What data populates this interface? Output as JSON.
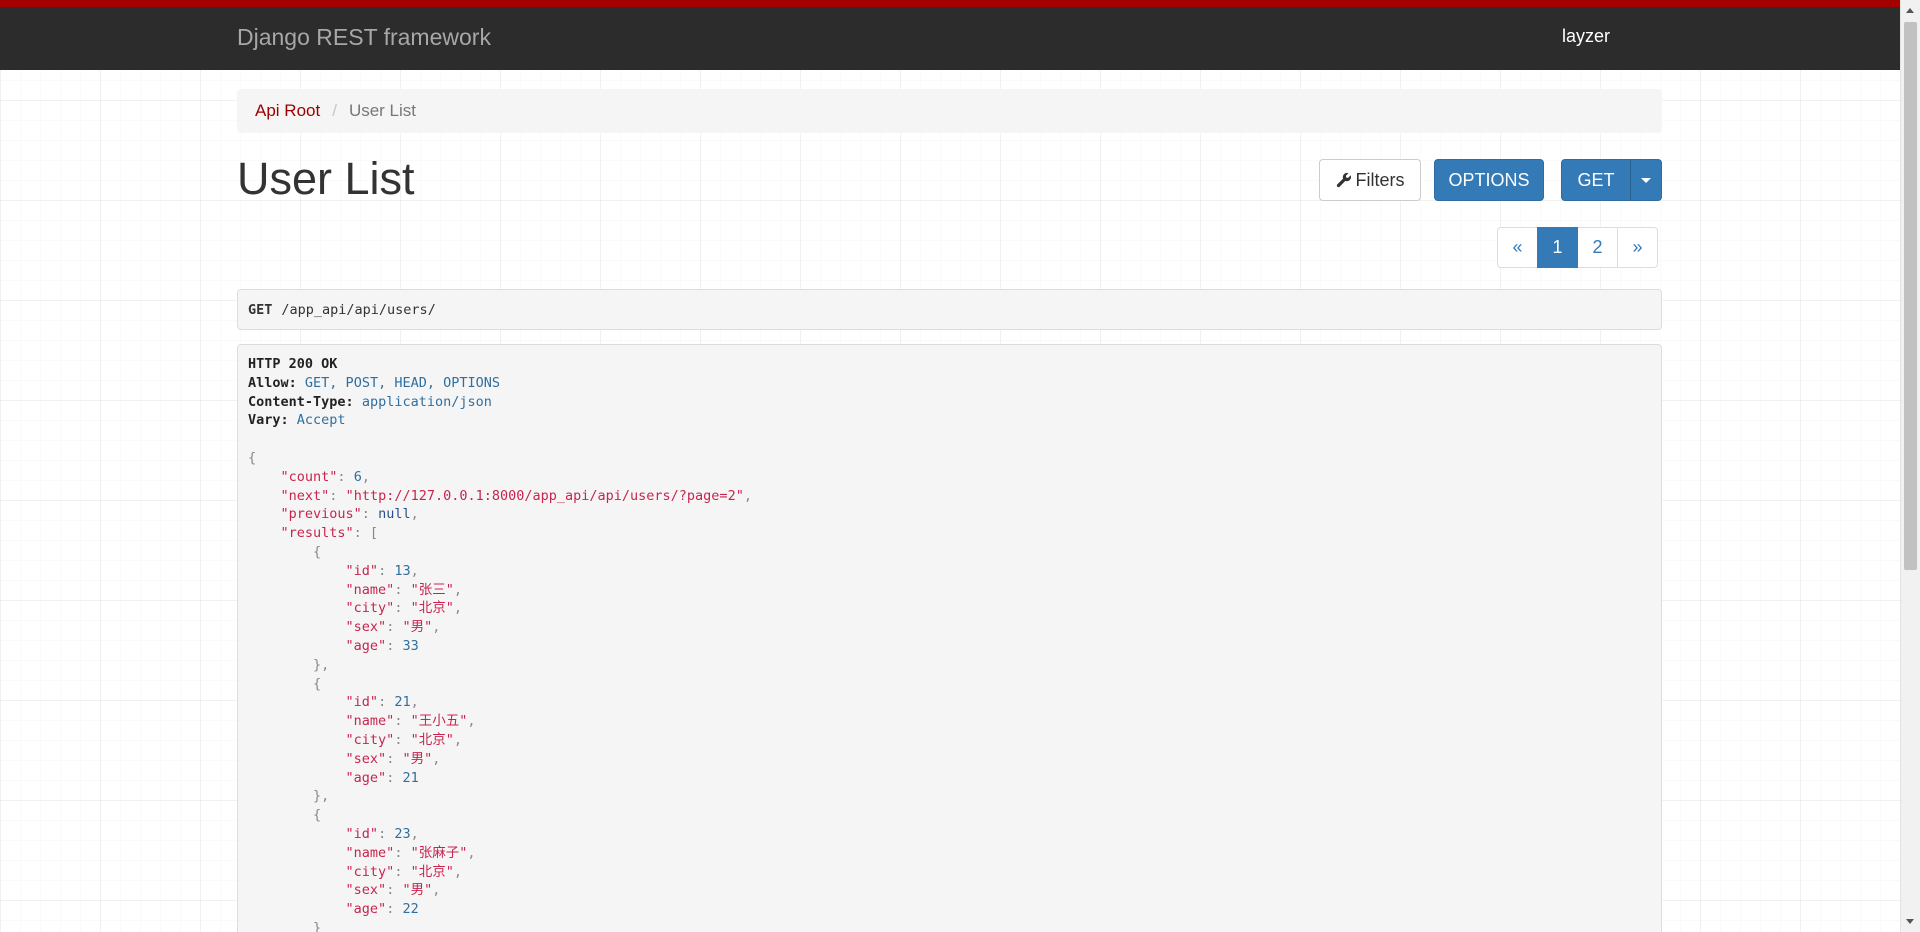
{
  "navbar": {
    "brand": "Django REST framework",
    "user": "layzer"
  },
  "breadcrumb": {
    "root": "Api Root",
    "separator": "/",
    "current": "User List"
  },
  "page_title": "User List",
  "toolbar": {
    "filters_label": "Filters",
    "options_label": "OPTIONS",
    "get_label": "GET"
  },
  "pagination": {
    "prev": "«",
    "pages": [
      "1",
      "2"
    ],
    "current": "1",
    "next": "»"
  },
  "request": {
    "method": "GET",
    "path": "/app_api/api/users/"
  },
  "response": {
    "status": "HTTP 200 OK",
    "headers": [
      {
        "key": "Allow:",
        "value": "GET, POST, HEAD, OPTIONS"
      },
      {
        "key": "Content-Type:",
        "value": "application/json"
      },
      {
        "key": "Vary:",
        "value": "Accept"
      }
    ],
    "body": {
      "count": "6",
      "next": "\"http://127.0.0.1:8000/app_api/api/users/?page=2\"",
      "previous": "null",
      "results": [
        {
          "id": "13",
          "name": "\"张三\"",
          "city": "\"北京\"",
          "sex": "\"男\"",
          "age": "33"
        },
        {
          "id": "21",
          "name": "\"王小五\"",
          "city": "\"北京\"",
          "sex": "\"男\"",
          "age": "21"
        },
        {
          "id": "23",
          "name": "\"张麻子\"",
          "city": "\"北京\"",
          "sex": "\"男\"",
          "age": "22"
        }
      ]
    },
    "keys": {
      "count": "\"count\"",
      "next": "\"next\"",
      "previous": "\"previous\"",
      "results": "\"results\"",
      "id": "\"id\"",
      "name": "\"name\"",
      "city": "\"city\"",
      "sex": "\"sex\"",
      "age": "\"age\""
    }
  },
  "colors": {
    "navbar_bg": "#2c2c2c",
    "navbar_accent": "#a30000",
    "primary": "#337ab7",
    "breadcrumb_link": "#9b0000",
    "json_string": "#c7254e"
  }
}
